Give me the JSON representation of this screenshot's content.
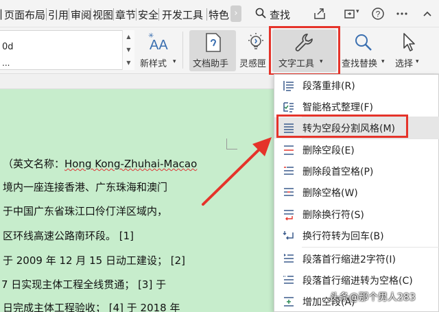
{
  "menubar": {
    "tabs": [
      "页面布局",
      "引用",
      "审阅",
      "视图",
      "章节",
      "安全",
      "开发工具",
      "特色"
    ],
    "search_label": "查找"
  },
  "ribbon": {
    "style_preview_text": "0d",
    "style_preview_dots": "...",
    "new_style_label": "新样式",
    "doc_assistant_label": "文档助手",
    "inspiration_label": "灵感匣",
    "text_tools_label": "文字工具",
    "find_replace_label": "查找替换",
    "select_label": "选择"
  },
  "document": {
    "lines": [
      {
        "text": "（英文名称：",
        "underlined": "Hong Kong-Zhuhai-Macao"
      },
      {
        "text": "境内一座连接香港、广东珠海和澳门"
      },
      {
        "text": "于中国广东省珠江口伶仃洋区域内，"
      },
      {
        "text": "区环线高速公路南环段。   [1]"
      },
      {
        "text": "于 2009 年 12 月 15 日动工建设；   [2]"
      },
      {
        "text": "7 日实现主体工程全线贯通；   [3]    于"
      },
      {
        "text": "日完成主体工程验收；  [4]    于 2018 年"
      }
    ]
  },
  "dropdown": {
    "items": [
      {
        "label": "段落重排(R)",
        "icon": "paragraph-rearrange-icon"
      },
      {
        "label": "智能格式整理(F)",
        "icon": "smart-format-icon"
      },
      {
        "label": "转为空段分割风格(M)",
        "icon": "empty-paragraph-split-icon"
      },
      {
        "label": "删除空段(E)",
        "icon": "delete-empty-paragraph-icon"
      },
      {
        "label": "删除段首空格(P)",
        "icon": "delete-leading-space-icon"
      },
      {
        "label": "删除空格(W)",
        "icon": "delete-space-icon"
      },
      {
        "label": "删除换行符(S)",
        "icon": "delete-line-break-icon"
      },
      {
        "label": "换行符转为回车(B)",
        "icon": "line-break-to-return-icon"
      },
      {
        "label": "段落首行缩进2字符(I)",
        "icon": "first-line-indent-icon"
      },
      {
        "label": "段落首行缩进转为空格(C)",
        "icon": "indent-to-space-icon"
      },
      {
        "label": "增加空段(A)",
        "icon": "add-empty-paragraph-icon"
      }
    ]
  },
  "watermark": "头条@那个男人283",
  "colors": {
    "highlight_red": "#e5332a",
    "document_bg": "#c7edcc",
    "menu_hover": "#e6e6e6"
  }
}
